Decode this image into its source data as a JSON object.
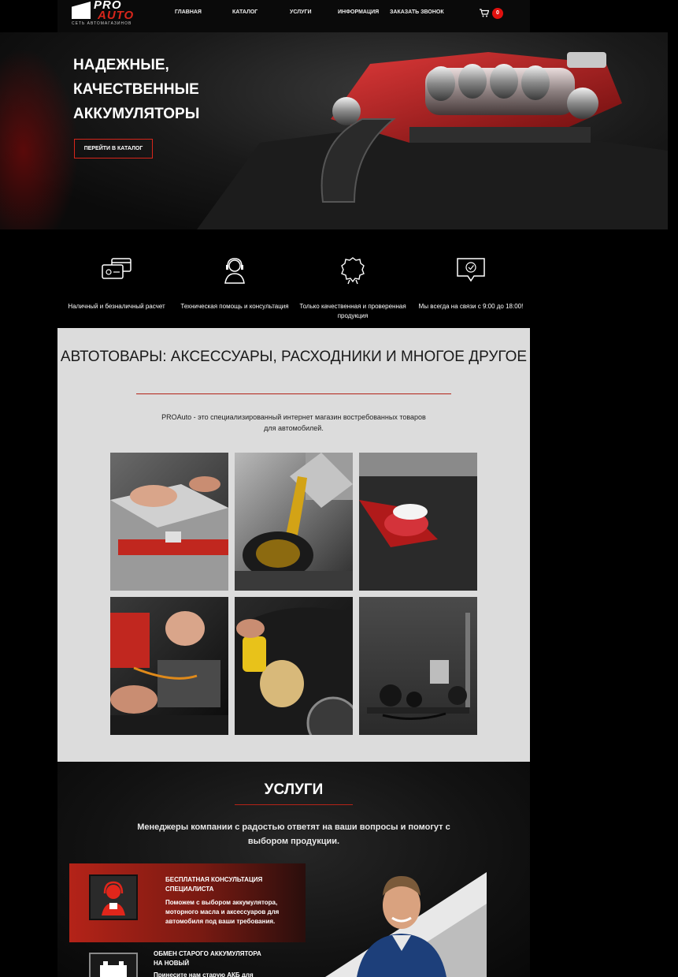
{
  "header": {
    "logo_pro": "PRO",
    "logo_auto": "AUTO",
    "logo_sub": "СЕТЬ АВТОМАГАЗИНОВ",
    "nav": [
      "ГЛАВНАЯ",
      "КАТАЛОГ",
      "УСЛУГИ",
      "ИНФОРМАЦИЯ",
      "ЗАКАЗАТЬ ЗВОНОК"
    ],
    "cart_icon": "cart-icon",
    "cart_count": "0"
  },
  "hero": {
    "title": "НАДЕЖНЫЕ, КАЧЕСТВЕННЫЕ АККУМУЛЯТОРЫ",
    "button": "ПЕРЕЙТИ В КАТАЛОГ"
  },
  "features": [
    {
      "icon": "payment-cards-icon",
      "text": "Наличный и безналичный расчет"
    },
    {
      "icon": "support-headset-icon",
      "text": "Техническая помощь и консультация"
    },
    {
      "icon": "quality-badge-icon",
      "text": "Только качественная и проверенная продукция"
    },
    {
      "icon": "chat-check-icon",
      "text": "Мы всегда на связи с 9:00 до 18:00!"
    }
  ],
  "products": {
    "title": "АВТОТОВАРЫ: АКСЕССУАРЫ, РАСХОДНИКИ И МНОГОЕ ДРУГОЕ",
    "lead": "PROAuto - это специализированный интернет магазин востребованных товаров для автомобилей.",
    "tiles": [
      "battery-photo",
      "engine-oil-photo",
      "engine-cleaning-photo",
      "wiring-repair-photo",
      "car-polishing-photo",
      "auto-parts-photo"
    ]
  },
  "services": {
    "title": "УСЛУГИ",
    "lead": "Менеджеры компании с радостью ответят на ваши вопросы и помогут с выбором продукции.",
    "items": [
      {
        "title": "БЕСПЛАТНАЯ КОНСУЛЬТАЦИЯ СПЕЦИАЛИСТА",
        "text": "Поможем с выбором аккумулятора, моторного масла и аксессуаров для автомобиля под ваши требования."
      },
      {
        "title": "ОБМЕН СТАРОГО АККУМУЛЯТОРА НА НОВЫЙ",
        "text": "Принесите нам старую АКБ для"
      }
    ]
  },
  "colors": {
    "accent": "#d7261b",
    "dark": "#0a0a0a",
    "panel": "#dcdcdc"
  }
}
